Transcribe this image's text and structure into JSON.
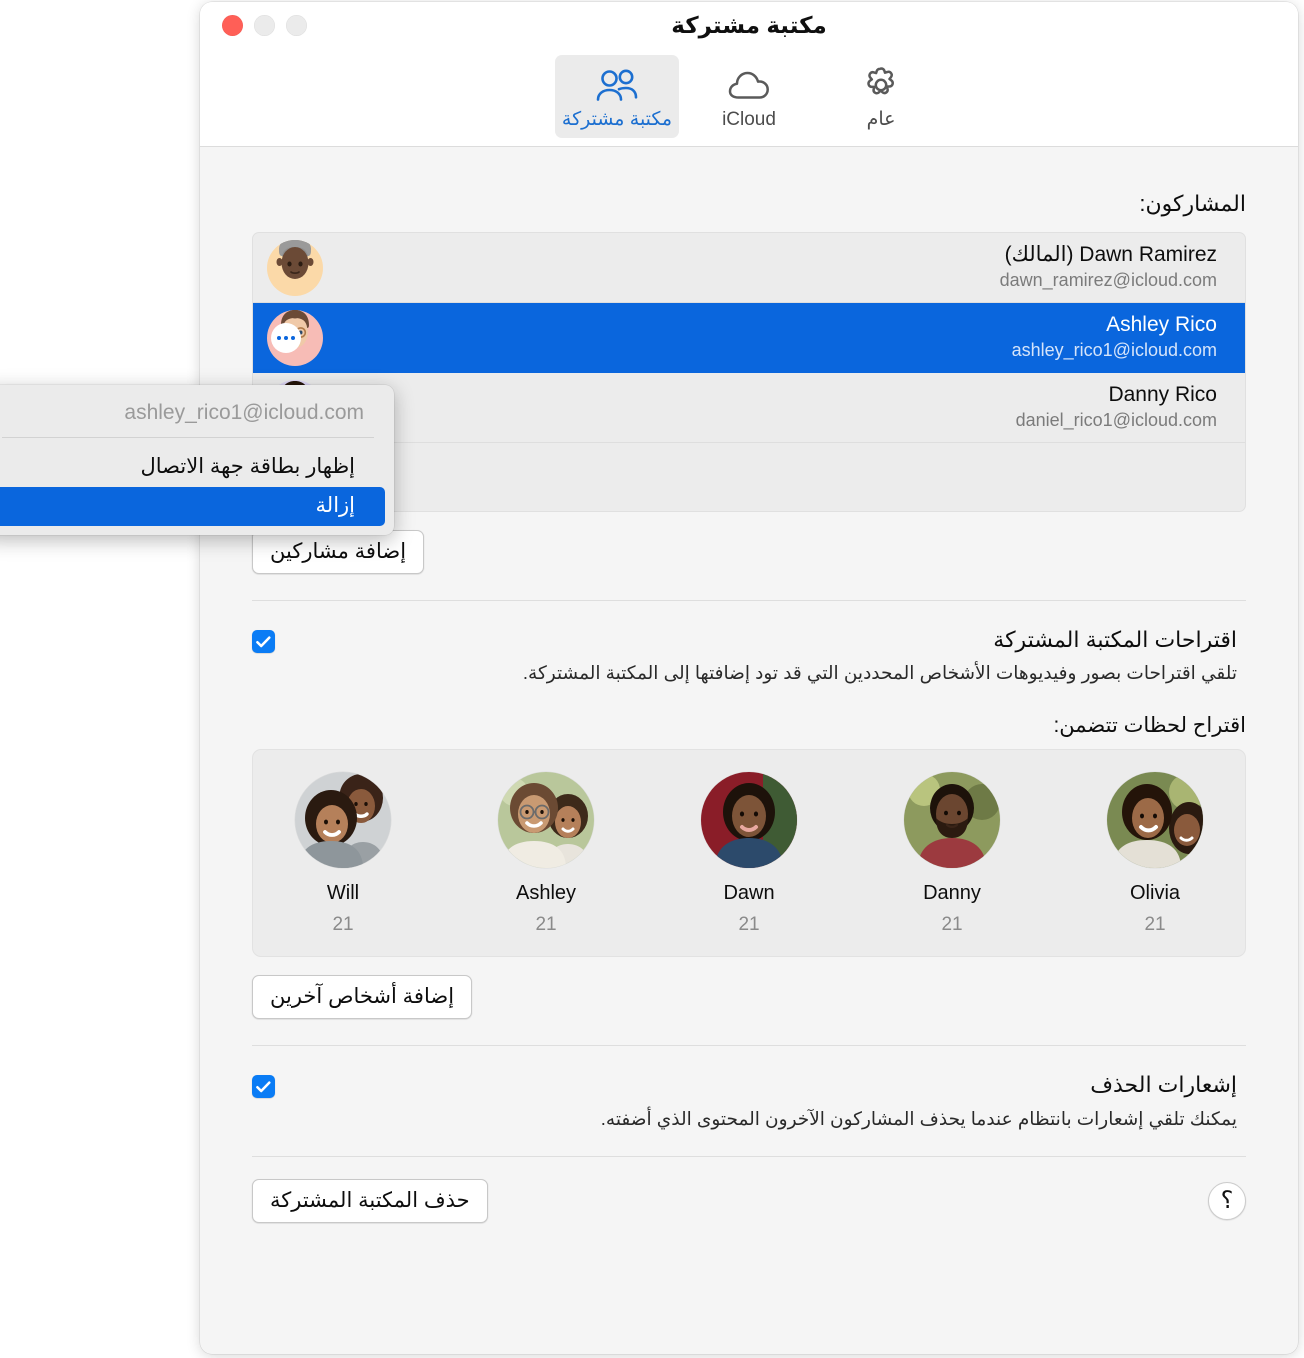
{
  "window": {
    "title": "مكتبة مشتركة",
    "traffic_lights": [
      "minimize",
      "maximize",
      "close"
    ],
    "accent_blue": "#0a66dd",
    "checkbox_blue": "#0a7cf5",
    "close_red": "#ff5f57"
  },
  "tabs": [
    {
      "label": "مكتبة مشتركة",
      "icon": "two-people-icon",
      "active": true
    },
    {
      "label": "iCloud",
      "icon": "cloud-icon",
      "active": false
    },
    {
      "label": "عام",
      "icon": "gear-icon",
      "active": false
    }
  ],
  "participants_section": {
    "label": "المشاركون:",
    "rows": [
      {
        "name": "Dawn Ramirez (المالك)",
        "email": "dawn_ramirez@icloud.com",
        "avatar": "memoji-older-woman",
        "avatar_bg": "#fbd9a8",
        "selected": false
      },
      {
        "name": "Ashley Rico",
        "email": "ashley_rico1@icloud.com",
        "avatar": "memoji-woman-glasses",
        "avatar_bg": "#f7bcb6",
        "selected": true,
        "more_button": "more-options-icon"
      },
      {
        "name": "Danny Rico",
        "email": "daniel_rico1@icloud.com",
        "avatar": "memoji-man-locs",
        "avatar_bg": "#ddd6f5",
        "selected": false
      },
      {
        "name": "",
        "email": "",
        "avatar": "memoji-partial",
        "avatar_bg": "#f8c6d8",
        "selected": false,
        "clipped": true
      }
    ],
    "add_button": "إضافة مشاركين"
  },
  "suggestions_section": {
    "checkbox_checked": true,
    "title": "اقتراحات المكتبة المشتركة",
    "description": "تلقي اقتراحات بصور وفيديوهات الأشخاص المحددين التي قد تود إضافتها إلى المكتبة المشتركة.",
    "moments_label": "اقتراح لحظات تتضمن:",
    "people": [
      {
        "name": "Will",
        "count": "21",
        "photo": "photo-girl-and-woman"
      },
      {
        "name": "Ashley",
        "count": "21",
        "photo": "photo-woman-glasses-and-girl"
      },
      {
        "name": "Dawn",
        "count": "21",
        "photo": "photo-woman-red-backdrop"
      },
      {
        "name": "Danny",
        "count": "21",
        "photo": "photo-man-beard-outdoors"
      },
      {
        "name": "Olivia",
        "count": "21",
        "photo": "photo-young-woman-smiling"
      }
    ],
    "add_people_button": "إضافة أشخاص آخرين"
  },
  "deletion_section": {
    "checkbox_checked": true,
    "title": "إشعارات الحذف",
    "description": "يمكنك تلقي إشعارات بانتظام عندما يحذف المشاركون الآخرون المحتوى الذي أضفته."
  },
  "footer": {
    "delete_library_button": "حذف المكتبة المشتركة",
    "help_button": "؟"
  },
  "context_menu": {
    "header": "ashley_rico1@icloud.com",
    "items": [
      {
        "label": "إظهار بطاقة جهة الاتصال",
        "selected": false
      },
      {
        "label": "إزالة",
        "selected": true
      }
    ]
  }
}
